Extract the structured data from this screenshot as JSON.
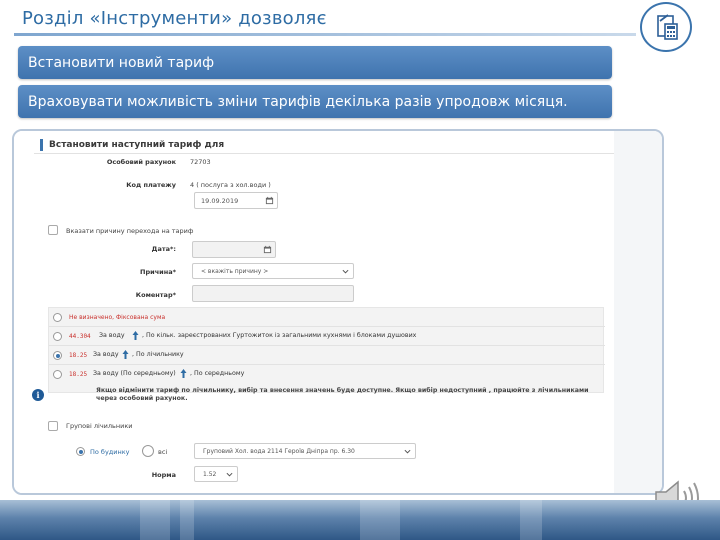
{
  "slide": {
    "title": "Розділ «Інструменти» дозволяє",
    "banners": [
      "Встановити новий тариф",
      "Враховувати можливість зміни тарифів декілька разів упродовж місяця."
    ]
  },
  "form": {
    "heading": "Встановити наступний тариф для",
    "account_label": "Особовий рахунок",
    "account_value": "72703",
    "payment_code_label": "Код платежу",
    "payment_code_value": "4 ( послуга з хол.води )",
    "date_value": "19.09.2019",
    "reason_checkbox_label": "Вказати причину перехода на тариф",
    "date_label": "Дата*:",
    "reason_label": "Причина*",
    "reason_placeholder": "< вкажіть причину >",
    "comment_label": "Коментар*",
    "tariff_options": [
      {
        "tariff": "Не визначено, Фіксована сума",
        "label": "",
        "desc": "",
        "selected": false
      },
      {
        "tariff": "44.304",
        "label": "За воду",
        "desc": ", По кільк. зареєстрованих Гуртожиток із загальними кухнями і блоками душових",
        "selected": false
      },
      {
        "tariff": "18.25",
        "label": "За воду",
        "desc": ", По лічильнику",
        "selected": true
      },
      {
        "tariff": "18.25",
        "label": "За воду (По середньому)",
        "desc": ", По середньому",
        "selected": false
      }
    ],
    "info_note": "Якщо відмінити тариф по лічильнику, вибір та внесення значень буде доступне. Якщо вибір недоступний , працюйте з лічильниками через особовий рахунок.",
    "group_meters_label": "Групові лічильники",
    "by_building_label": "По будинку",
    "all_label": "всі",
    "group_meter_value": "Груповий Хол. вода 2114 Героїв Дніпра пр. 6.30",
    "norm_label": "Норма",
    "norm_value": "1.52"
  },
  "colors": {
    "accent": "#3b74ad",
    "banner": "#4a7fb9",
    "tariff_red": "#c9302c"
  },
  "icons": [
    "document-calculator-icon",
    "calendar-icon",
    "chevron-down-icon",
    "arrow-up-icon",
    "info-icon",
    "speaker-icon"
  ]
}
